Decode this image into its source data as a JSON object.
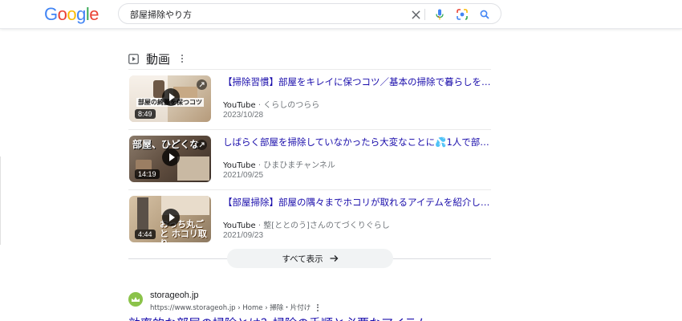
{
  "logo": {
    "text": [
      "G",
      "o",
      "o",
      "g",
      "l",
      "e"
    ],
    "colors": [
      "#4285f4",
      "#ea4335",
      "#fbbc05",
      "#4285f4",
      "#34a853",
      "#ea4335"
    ]
  },
  "search": {
    "query": "部屋掃除やり方"
  },
  "icons": {
    "clear": "close-icon",
    "voice": "microphone-icon",
    "lens": "google-lens-icon",
    "search": "search-icon"
  },
  "videos": {
    "heading": "動画",
    "items": [
      {
        "title": "【掃除習慣】部屋をキレイに保つコツ／基本の掃除で暮らしを整…",
        "platform": "YouTube",
        "channel": "くらしのつらら",
        "date": "2023/10/28",
        "duration": "8:49",
        "thumb_caption": "部屋の綺麗を保つコツ"
      },
      {
        "title": "しばらく部屋を掃除していなかったら大変なことに💦1人で部屋…",
        "platform": "YouTube",
        "channel": "ひまひまチャンネル",
        "date": "2021/09/25",
        "duration": "14:19",
        "thumb_caption": "部屋、ひどくな"
      },
      {
        "title": "【部屋掃除】部屋の隅々までホコリが取れるアイテムを紹介します",
        "platform": "YouTube",
        "channel": "整[ととのう]さんのてづくりぐらし",
        "date": "2021/09/23",
        "duration": "4:44",
        "thumb_caption": "おっち丸ごと ホコリ取り"
      }
    ],
    "show_all": "すべて表示"
  },
  "result": {
    "site_name": "storageoh.jp",
    "url": "https://www.storageoh.jp › Home › 掃除・片付け",
    "title": "効率的な部屋の掃除とは？掃除の手順と必要なアイテム"
  }
}
